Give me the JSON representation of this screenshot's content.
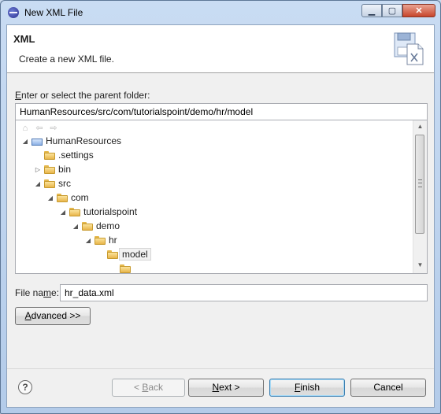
{
  "window": {
    "title": "New XML File"
  },
  "banner": {
    "title": "XML",
    "description": "Create a new XML file."
  },
  "parent_folder": {
    "label_underlined": "E",
    "label_rest": "nter or select the parent folder:",
    "value": "HumanResources/src/com/tutorialspoint/demo/hr/model"
  },
  "tree": {
    "items": [
      {
        "label": "HumanResources",
        "twisty": "◢"
      },
      {
        "label": ".settings",
        "twisty": ""
      },
      {
        "label": "bin",
        "twisty": "▷"
      },
      {
        "label": "src",
        "twisty": "◢"
      },
      {
        "label": "com",
        "twisty": "◢"
      },
      {
        "label": "tutorialspoint",
        "twisty": "◢"
      },
      {
        "label": "demo",
        "twisty": "◢"
      },
      {
        "label": "hr",
        "twisty": "◢"
      },
      {
        "label": "model",
        "twisty": ""
      }
    ]
  },
  "file_name": {
    "label_pre": "File na",
    "label_underlined": "m",
    "label_post": "e:",
    "value": "hr_data.xml"
  },
  "buttons": {
    "advanced": {
      "underlined": "A",
      "rest": "dvanced >>"
    },
    "back": {
      "pre": "< ",
      "underlined": "B",
      "rest": "ack"
    },
    "next": {
      "underlined": "N",
      "rest": "ext >"
    },
    "finish": {
      "underlined": "F",
      "rest": "inish"
    },
    "cancel": "Cancel",
    "help": "?"
  }
}
